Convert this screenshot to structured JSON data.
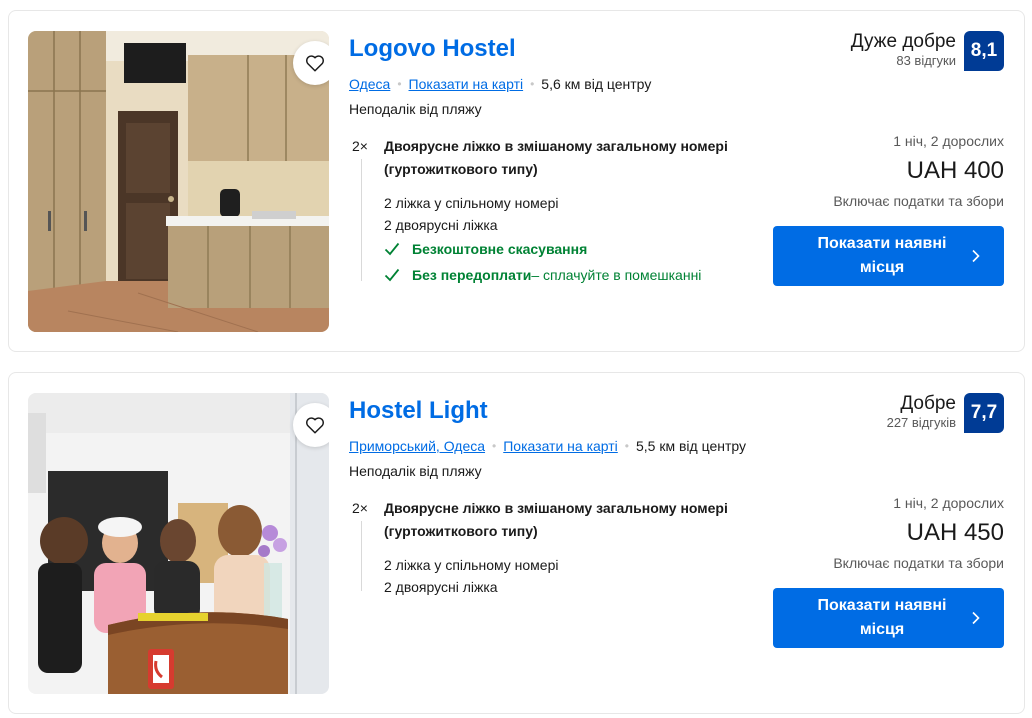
{
  "listings": [
    {
      "name": "Logovo Hostel",
      "location_parts": [
        "Одеса"
      ],
      "map_link": "Показати на карті",
      "distance": "5,6 км від центру",
      "feature": "Неподалік від пляжу",
      "room_multiplier": "2×",
      "room_title": "Двоярусне ліжко в змішаному загальному номері (гуртожиткового типу)",
      "room_line1": "2 ліжка у спільному номері",
      "room_line2": "2 двоярусні ліжка",
      "benefit1": "Безкоштовне скасування",
      "benefit2": "Без передоплати",
      "benefit2_rest": " – сплачуйте в помешканні",
      "rating_word": "Дуже добре",
      "review_count": "83 відгуки",
      "score": "8,1",
      "stay": "1 ніч, 2 дорослих",
      "price": "UAH 400",
      "taxes": "Включає податки та збори",
      "cta_label": "Показати наявні місця"
    },
    {
      "name": "Hostel Light",
      "location_parts": [
        "Приморський, Одеса"
      ],
      "map_link": "Показати на карті",
      "distance": "5,5 км від центру",
      "feature": "Неподалік від пляжу",
      "room_multiplier": "2×",
      "room_title": "Двоярусне ліжко в змішаному загальному номері (гуртожиткового типу)",
      "room_line1": "2 ліжка у спільному номері",
      "room_line2": "2 двоярусні ліжка",
      "rating_word": "Добре",
      "review_count": "227 відгуків",
      "score": "7,7",
      "stay": "1 ніч, 2 дорослих",
      "price": "UAH 450",
      "taxes": "Включає податки та збори",
      "cta_label": "Показати наявні місця"
    }
  ],
  "colors": {
    "link": "#006ce4",
    "score_bg": "#003b95",
    "benefit": "#008234",
    "cta_bg": "#006ce4"
  },
  "icons": {
    "favorite": "heart-outline-icon",
    "benefit": "checkmark-icon",
    "cta": "chevron-right-icon"
  }
}
